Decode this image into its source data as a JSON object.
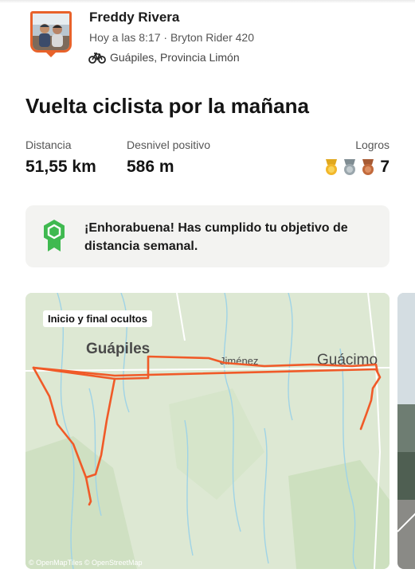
{
  "header": {
    "athlete_name": "Freddy Rivera",
    "meta": "Hoy a las 8:17 · Bryton Rider 420",
    "location": "Guápiles, Provincia Limón",
    "activity_icon": "bike-icon"
  },
  "activity": {
    "title": "Vuelta ciclista por la mañana"
  },
  "stats": {
    "distance_label": "Distancia",
    "distance_value": "51,55 km",
    "elevation_label": "Desnivel positivo",
    "elevation_value": "586 m",
    "achievements_label": "Logros",
    "achievements_count": "7",
    "medal_icons": [
      "gold-medal-icon",
      "silver-medal-icon",
      "bronze-medal-icon"
    ]
  },
  "goal": {
    "message": "¡Enhorabuena! Has cumplido tu objetivo de distancia semanal.",
    "icon": "goal-badge-icon"
  },
  "map": {
    "badge": "Inicio y final ocultos",
    "place_labels": [
      "Guápiles",
      "Jiménez",
      "Guácimo"
    ],
    "attribution": "© OpenMapTiles © OpenStreetMap",
    "route_color": "#f05a28"
  },
  "colors": {
    "accent": "#fc5200",
    "goal_green": "#3fb950",
    "card_bg": "#f3f3f1"
  }
}
